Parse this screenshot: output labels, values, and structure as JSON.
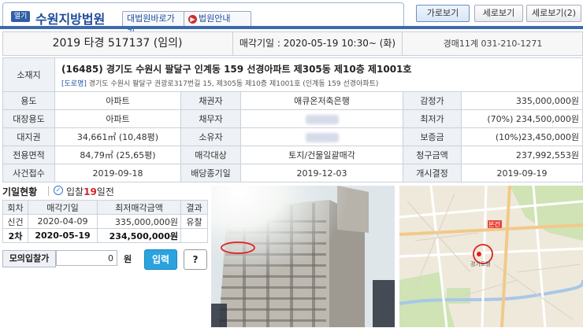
{
  "header": {
    "badge": "열기",
    "court_name": "수원지방법원",
    "scourt_link": "대법원바로가기",
    "info_link": "법원안내",
    "views": [
      "가로보기",
      "세로보기",
      "세로보기(2)"
    ]
  },
  "case": {
    "case_number": "2019 타경 517137 (임의)",
    "sale_date": "매각기일 : 2020-05-19 10:30~ (화)",
    "department": "경매11계 031-210-1271"
  },
  "property": {
    "location_label": "소재지",
    "address": "(16485) 경기도 수원시 팔달구 인계동 159 선경아파트 제305동 제10층 제1001호",
    "road_tag": "[도로명]",
    "road_address": "경기도 수원시 팔달구 권광로317번길 15, 제305동 제10층 제1001호 (인계동 159 선경아파트)",
    "rows": [
      [
        {
          "l": "용도",
          "v": "아파트"
        },
        {
          "l": "채권자",
          "v": "애큐온저축은행"
        },
        {
          "l": "감정가",
          "v": "335,000,000원"
        }
      ],
      [
        {
          "l": "대장용도",
          "v": "아파트"
        },
        {
          "l": "채무자",
          "v": ""
        },
        {
          "l": "최저가",
          "v": "(70%) 234,500,000원"
        }
      ],
      [
        {
          "l": "대지권",
          "v": "34,661㎡ (10,48평)"
        },
        {
          "l": "소유자",
          "v": ""
        },
        {
          "l": "보증금",
          "v": "(10%)23,450,000원"
        }
      ],
      [
        {
          "l": "전용면적",
          "v": "84,79㎡ (25,65평)"
        },
        {
          "l": "매각대상",
          "v": "토지/건물일괄매각"
        },
        {
          "l": "청구금액",
          "v": "237,992,553원"
        }
      ],
      [
        {
          "l": "사건접수",
          "v": "2019-09-18"
        },
        {
          "l": "배당종기일",
          "v": "2019-12-03"
        },
        {
          "l": "개시결정",
          "v": "2019-09-19"
        }
      ]
    ]
  },
  "status": {
    "title": "기일현황",
    "dday_prefix": "입찰",
    "dday_num": "19",
    "dday_suffix": "일전",
    "headers": [
      "회차",
      "매각기일",
      "최저매각금액",
      "결과"
    ],
    "rows": [
      {
        "round": "신건",
        "date": "2020-04-09",
        "price": "335,000,000원",
        "result": "유찰"
      },
      {
        "round": "2차",
        "date": "2020-05-19",
        "price": "234,500,000원",
        "result": ""
      }
    ]
  },
  "bid": {
    "label": "모의입찰가",
    "value": "0",
    "unit": "원",
    "submit": "입력",
    "help": "?"
  },
  "map": {
    "tag": "본건",
    "place_label": "경기도청"
  },
  "colors": {
    "brand": "#1e4c9a",
    "accent": "#2aa3df",
    "red": "#c4262e"
  }
}
